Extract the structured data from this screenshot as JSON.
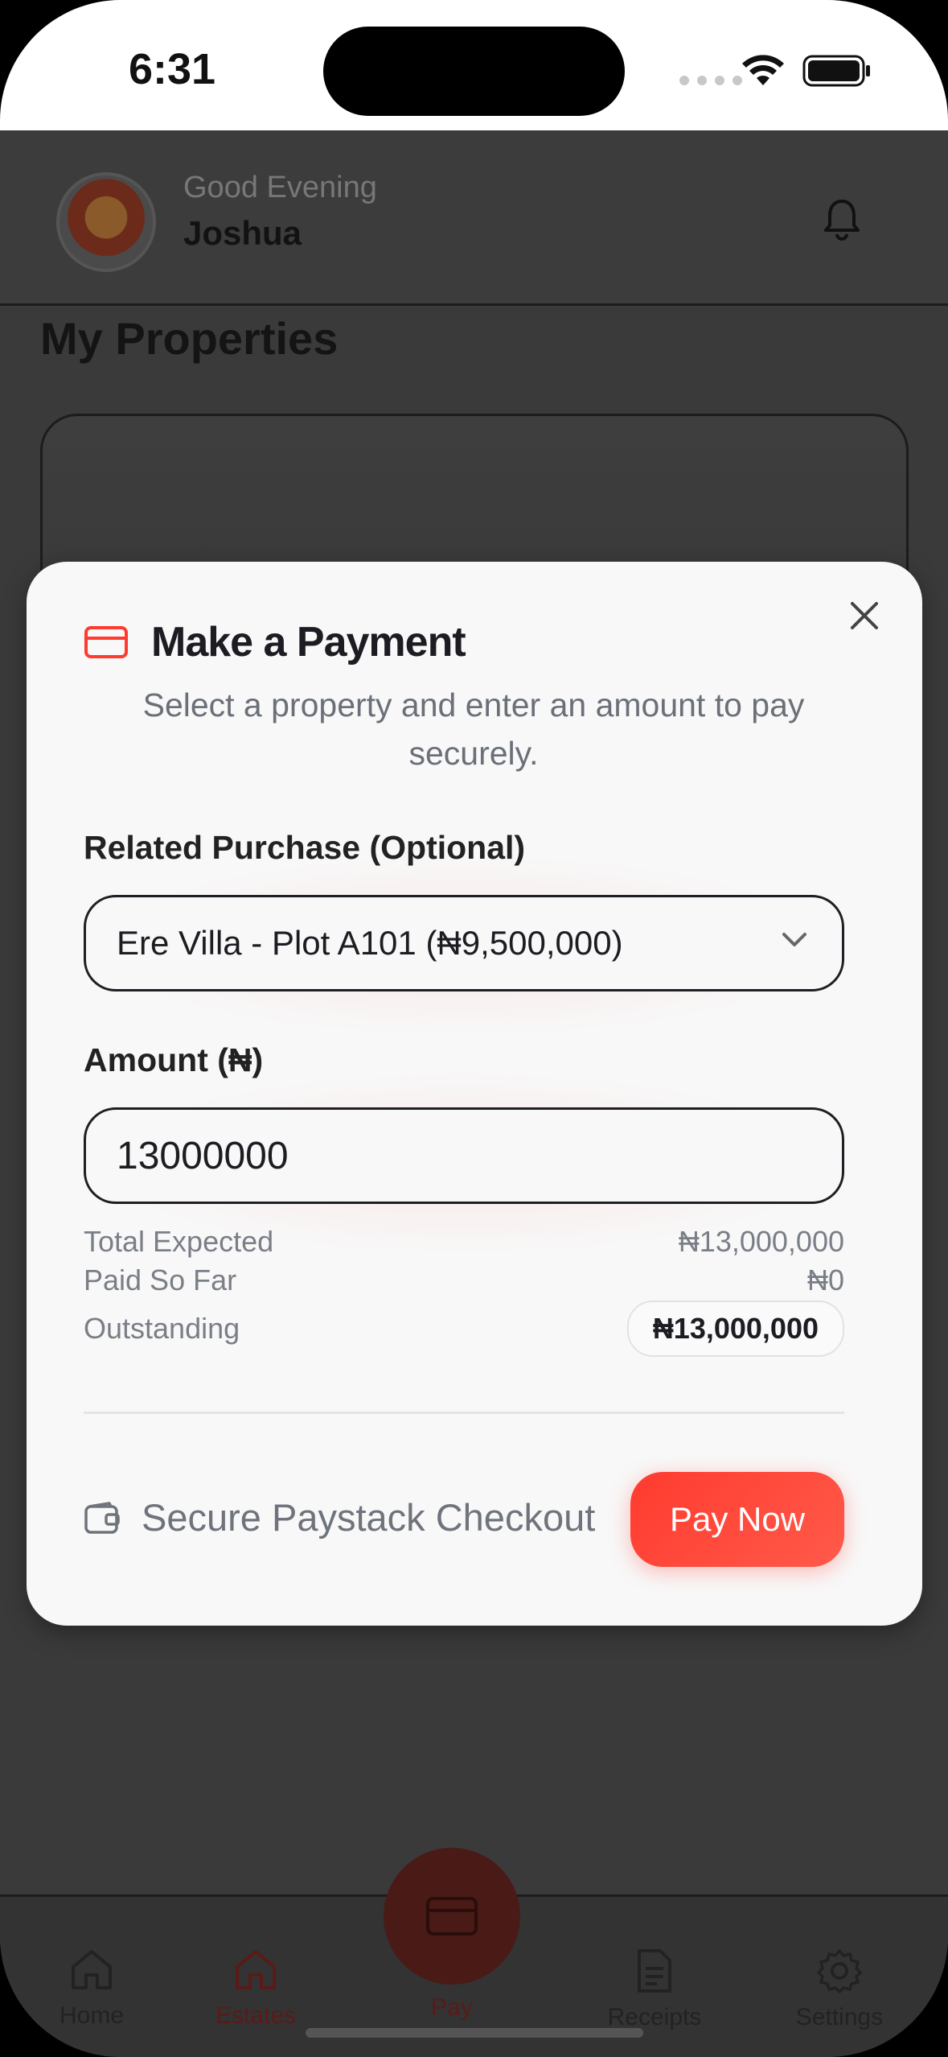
{
  "status_bar": {
    "time": "6:31"
  },
  "header": {
    "greeting": "Good Evening",
    "user_name": "Joshua"
  },
  "main": {
    "section_title": "My Properties"
  },
  "modal": {
    "title": "Make a Payment",
    "subtitle": "Select a property and enter an amount to pay securely.",
    "related_label": "Related Purchase (Optional)",
    "related_selected": "Ere Villa - Plot A101 (₦9,500,000)",
    "amount_label": "Amount (₦)",
    "amount_value": "13000000",
    "summary": {
      "total_expected_label": "Total Expected",
      "total_expected_value": "₦13,000,000",
      "paid_label": "Paid So Far",
      "paid_value": "₦0",
      "outstanding_label": "Outstanding",
      "outstanding_value": "₦13,000,000"
    },
    "secure_text": "Secure Paystack Checkout",
    "pay_button": "Pay Now"
  },
  "tabbar": {
    "items": [
      {
        "label": "Home",
        "icon": "home-icon"
      },
      {
        "label": "Estates",
        "icon": "estates-icon"
      },
      {
        "label": "Pay",
        "icon": "card-icon"
      },
      {
        "label": "Receipts",
        "icon": "receipt-icon"
      },
      {
        "label": "Settings",
        "icon": "gear-icon"
      }
    ]
  },
  "colors": {
    "accent": "#FF3B2F",
    "overlay": "#3A3A3A",
    "modal_bg": "#F8F8F8"
  }
}
